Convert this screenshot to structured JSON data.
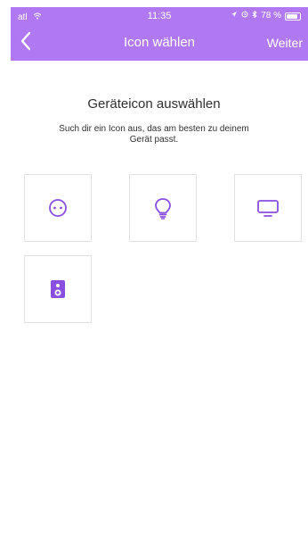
{
  "statusbar": {
    "time": "11:35",
    "battery_text": "78 %",
    "signal_label": "atl"
  },
  "navbar": {
    "title": "Icon wählen",
    "next_label": "Weiter"
  },
  "content": {
    "heading": "Geräteicon auswählen",
    "subheading": "Such dir ein Icon aus, das am besten zu deinem Gerät passt."
  },
  "icons": [
    {
      "name": "socket-icon"
    },
    {
      "name": "lightbulb-icon"
    },
    {
      "name": "tv-icon"
    },
    {
      "name": "speaker-icon"
    }
  ],
  "colors": {
    "accent": "#b178f4",
    "icon": "#8a4fe1",
    "border": "#e1e1e1",
    "text": "#2f2f2f"
  }
}
